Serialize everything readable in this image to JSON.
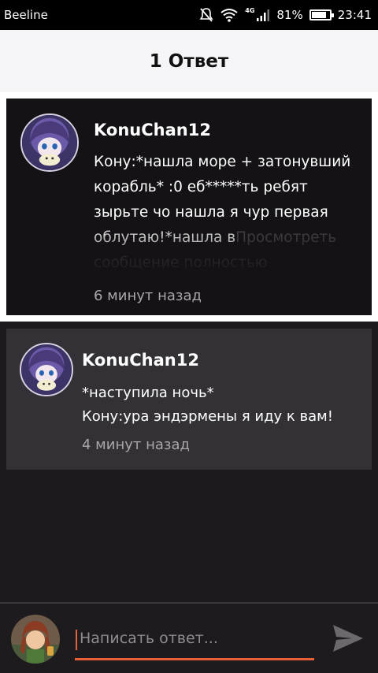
{
  "status_bar": {
    "carrier": "Beeline",
    "network_type": "4G",
    "battery_percent": "81%",
    "battery_level": 0.81,
    "time": "23:41"
  },
  "header": {
    "title": "1 Ответ"
  },
  "post": {
    "author": "KonuChan12",
    "text": "Кону:*нашла море + затонувший корабль* :0 еб*****ть ребят зырьте чо нашла я чур первая облутаю!*нашла в",
    "view_full_label": "Просмотреть сообщение полностью",
    "time": "6 минут назад"
  },
  "reply": {
    "author": "KonuChan12",
    "line1": "*наступила ночь*",
    "line2": "Кону:ура эндэрмены я иду к вам!",
    "time": "4 минут назад"
  },
  "composer": {
    "placeholder": "Написать ответ...",
    "value": ""
  },
  "icons": {
    "mute": "mute-icon",
    "wifi": "wifi-icon",
    "signal": "signal-icon",
    "battery": "battery-icon",
    "send": "send-icon"
  },
  "colors": {
    "accent": "#e6603a",
    "post_bg": "#141215",
    "reply_bg": "#333136",
    "page_bg": "#1c1a1d"
  }
}
